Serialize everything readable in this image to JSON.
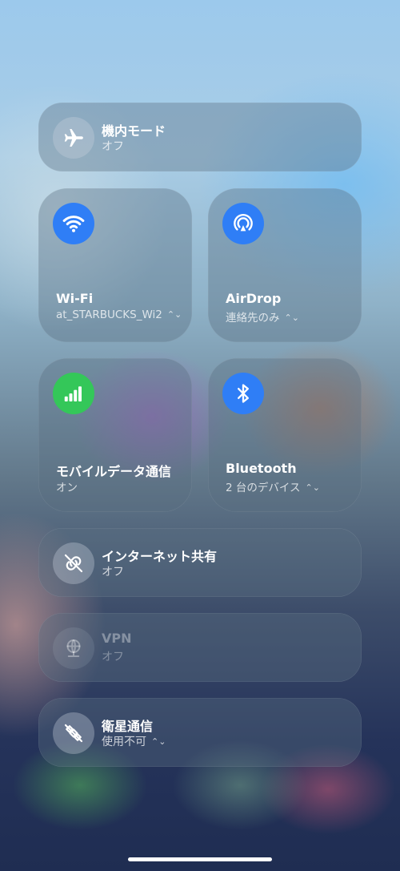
{
  "airplane": {
    "title": "機内モード",
    "status": "オフ",
    "icon": "airplane-icon"
  },
  "wifi": {
    "title": "Wi-Fi",
    "network": "at_STARBUCKS_Wi2",
    "icon": "wifi-icon",
    "color": "#2f7ef6"
  },
  "airdrop": {
    "title": "AirDrop",
    "status": "連絡先のみ",
    "icon": "airdrop-icon",
    "color": "#2f7ef6"
  },
  "cellular": {
    "title": "モバイルデータ通信",
    "status": "オン",
    "icon": "cellular-icon",
    "color": "#34c759"
  },
  "bluetooth": {
    "title": "Bluetooth",
    "status": "2 台のデバイス",
    "icon": "bluetooth-icon",
    "color": "#2f7ef6"
  },
  "hotspot": {
    "title": "インターネット共有",
    "status": "オフ",
    "icon": "link-icon"
  },
  "vpn": {
    "title": "VPN",
    "status": "オフ",
    "icon": "vpn-icon"
  },
  "satellite": {
    "title": "衛星通信",
    "status": "使用不可",
    "icon": "satellite-icon"
  }
}
